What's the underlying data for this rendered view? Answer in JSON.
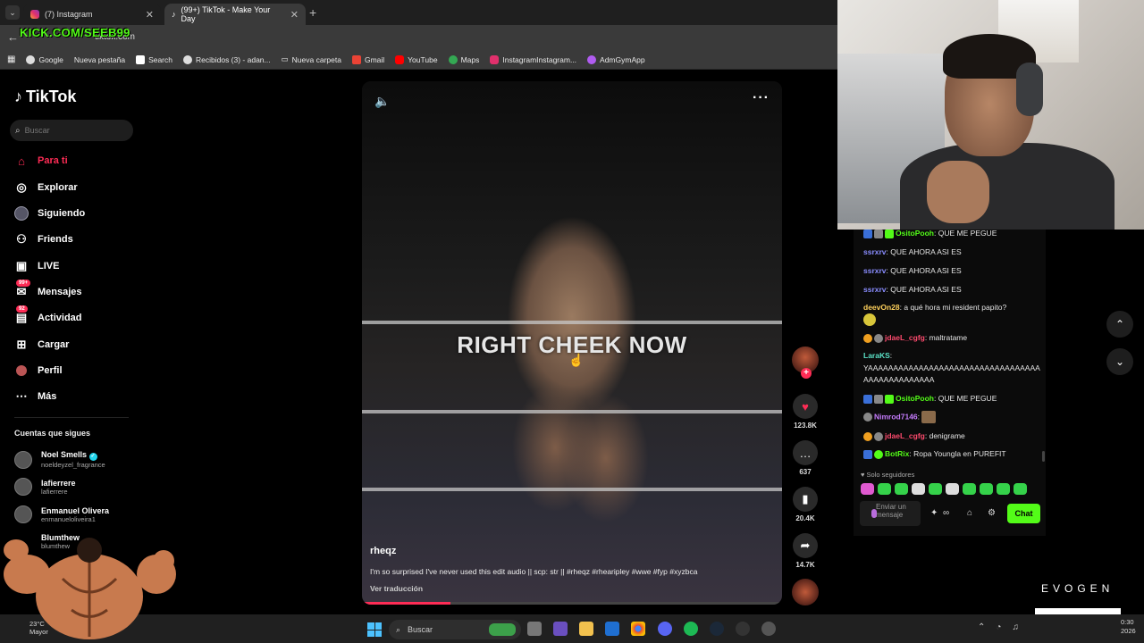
{
  "browser": {
    "tabs": [
      {
        "label": "(7) Instagram",
        "icon": "instagram-icon"
      },
      {
        "label": "(99+) TikTok - Make Your Day",
        "icon": "tiktok-icon"
      }
    ],
    "url": "tiktok.com",
    "bookmarks": [
      "Google",
      "Nueva pestaña",
      "Search",
      "Recibidos (3) - adan...",
      "Nueva carpeta",
      "Gmail",
      "YouTube",
      "Maps",
      "InstagramInstagram...",
      "AdmGymApp"
    ]
  },
  "stream_overlay": {
    "kick_handle": "KICK.COM/SEEB99",
    "brand": "EVOGEN"
  },
  "tiktok": {
    "logo": "TikTok",
    "search_placeholder": "Buscar",
    "nav": [
      {
        "label": "Para ti",
        "icon": "home-icon",
        "active": true
      },
      {
        "label": "Explorar",
        "icon": "compass-icon"
      },
      {
        "label": "Siguiendo",
        "icon": "following-avatar-icon"
      },
      {
        "label": "Friends",
        "icon": "friends-icon"
      },
      {
        "label": "LIVE",
        "icon": "live-icon"
      },
      {
        "label": "Mensajes",
        "icon": "messages-icon",
        "badge": "99+"
      },
      {
        "label": "Actividad",
        "icon": "activity-icon",
        "badge": "92"
      },
      {
        "label": "Cargar",
        "icon": "upload-icon"
      },
      {
        "label": "Perfil",
        "icon": "profile-icon"
      },
      {
        "label": "Más",
        "icon": "more-icon"
      }
    ],
    "following_title": "Cuentas que sigues",
    "following": [
      {
        "name": "Noel Smells",
        "user": "noeldeyzel_fragrance",
        "verified": true
      },
      {
        "name": "lafierrere",
        "user": "lafierrere"
      },
      {
        "name": "Enmanuel Olivera",
        "user": "enmanueloliveira1"
      },
      {
        "name": "Blumthew",
        "user": "blumthew"
      }
    ],
    "video": {
      "overlay_text": "RIGHT CHEEK NOW",
      "author": "rheqz",
      "caption": "I'm so surprised I've never used this edit audio || scp: str || #rheqz #rhearipley #wwe #fyp #xyzbca",
      "translate": "Ver traducción",
      "progress": 0.21
    },
    "actions": {
      "likes": "123.8K",
      "comments": "637",
      "saves": "20.4K",
      "shares": "14.7K"
    }
  },
  "chat": {
    "messages": [
      {
        "user": "OsitoPooh",
        "text": ": QUE ME PEGUE",
        "color": "#53fc18"
      },
      {
        "user": "ssrxrv",
        "text": ": QUE AHORA ASI ES",
        "color": "#8a8dff"
      },
      {
        "user": "ssrxrv",
        "text": ": QUE AHORA ASI ES",
        "color": "#8a8dff"
      },
      {
        "user": "ssrxrv",
        "text": ": QUE AHORA ASI ES",
        "color": "#8a8dff"
      },
      {
        "user": "deevOn28",
        "text": ": a qué hora mi resident papito?",
        "color": "#ffd15c"
      },
      {
        "user": "jdaeL_cgfg",
        "text": ": maltratame",
        "color": "#ff4b6e"
      },
      {
        "user": "LaraKS",
        "text": ":",
        "color": "#5be3c8"
      },
      {
        "user": "",
        "text": "YAAAAAAAAAAAAAAAAAAAAAAAAAAAAAAAAAAAAAAAAAAAAAAAA",
        "color": "#e5e5e5"
      },
      {
        "user": "OsitoPooh",
        "text": ": QUE ME PEGUE",
        "color": "#53fc18"
      },
      {
        "user": "Nimrod7146",
        "text": ":",
        "color": "#c77dff"
      },
      {
        "user": "jdaeL_cgfg",
        "text": ": denigrame",
        "color": "#ff4b6e"
      },
      {
        "user": "BotRix",
        "text": ": Ropa Youngla en PUREFIT",
        "color": "#53fc18"
      }
    ],
    "followers_only": "Solo seguidores",
    "input_placeholder": "Enviar un mensaje",
    "send_label": "Chat"
  },
  "taskbar": {
    "weather": "23°C",
    "weather_sub": "Mayor",
    "search_placeholder": "Buscar",
    "clock": "0:30",
    "date": "2026"
  }
}
